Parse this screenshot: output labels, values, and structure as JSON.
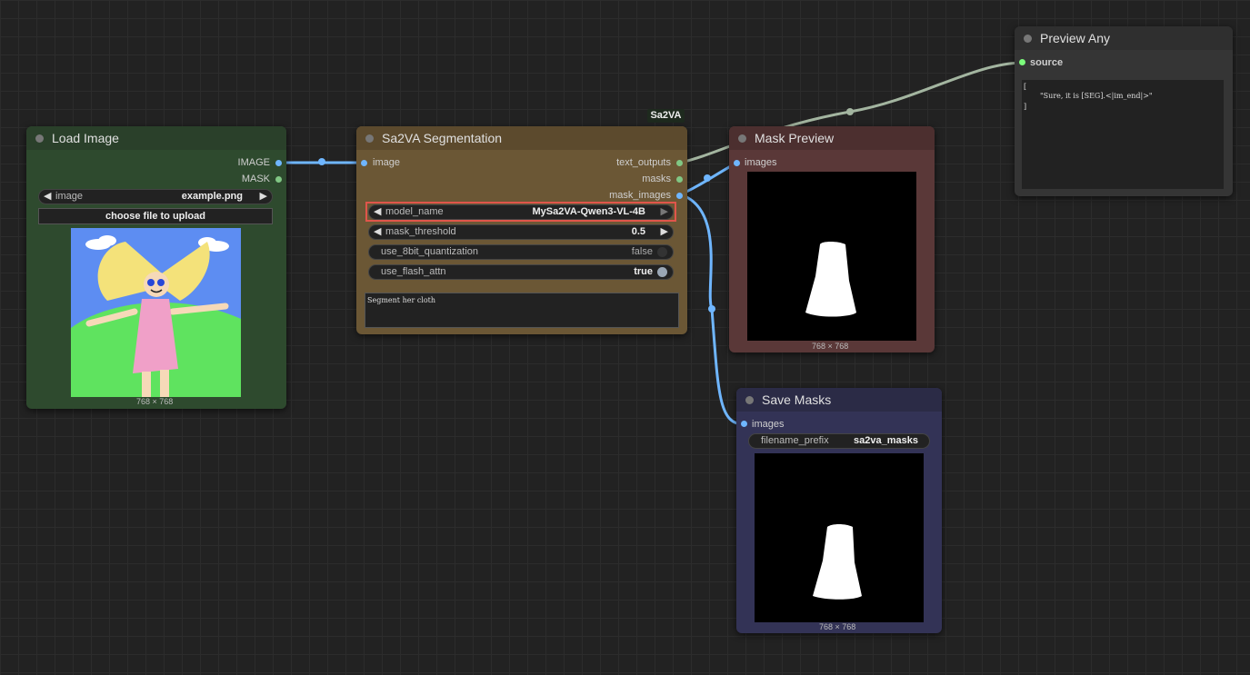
{
  "links_color": "#6fb6ff",
  "text_link_color": "#a3b5a0",
  "load_image": {
    "title": "Load Image",
    "output_image": "IMAGE",
    "output_mask": "MASK",
    "widget_image_label": "image",
    "widget_image_value": "example.png",
    "upload_button": "choose file to upload",
    "dims": "768 × 768"
  },
  "sa2va": {
    "badge": "Sa2VA",
    "title": "Sa2VA Segmentation",
    "input_image": "image",
    "output_text": "text_outputs",
    "output_masks": "masks",
    "output_mask_images": "mask_images",
    "model_name_label": "model_name",
    "model_name_value": "MySa2VA-Qwen3-VL-4B",
    "mask_threshold_label": "mask_threshold",
    "mask_threshold_value": "0.5",
    "quant_label": "use_8bit_quantization",
    "quant_value": "false",
    "flash_label": "use_flash_attn",
    "flash_value": "true",
    "prompt": "Segment her cloth"
  },
  "mask_preview": {
    "title": "Mask Preview",
    "input_images": "images",
    "dims": "768 × 768"
  },
  "preview_any": {
    "title": "Preview Any",
    "input_source": "source",
    "text_line1": "[",
    "text_line2": "\"Sure, it is [SEG].<|im_end|>\"",
    "text_line3": "]"
  },
  "save_masks": {
    "title": "Save Masks",
    "input_images": "images",
    "filename_prefix_label": "filename_prefix",
    "filename_prefix_value": "sa2va_masks",
    "dims": "768 × 768"
  }
}
